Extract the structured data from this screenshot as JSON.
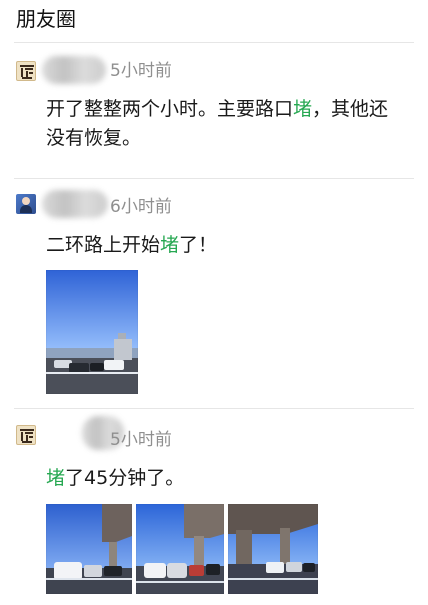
{
  "page": {
    "title": "朋友圈"
  },
  "posts": [
    {
      "time": "5小时前",
      "content_prefix": "开了整整两个小时。主要路口",
      "keyword": "堵",
      "content_suffix": "，其他还没有恢复。"
    },
    {
      "time": "6小时前",
      "content_prefix": "二环路上开始",
      "keyword": "堵",
      "content_suffix": "了！"
    },
    {
      "time": "5小时前",
      "content_prefix": "",
      "keyword": "堵",
      "content_suffix": "了45分钟了。"
    }
  ],
  "colors": {
    "keyword": "#27a852",
    "divider": "#e6e6e6",
    "time": "#8f8f8f"
  }
}
